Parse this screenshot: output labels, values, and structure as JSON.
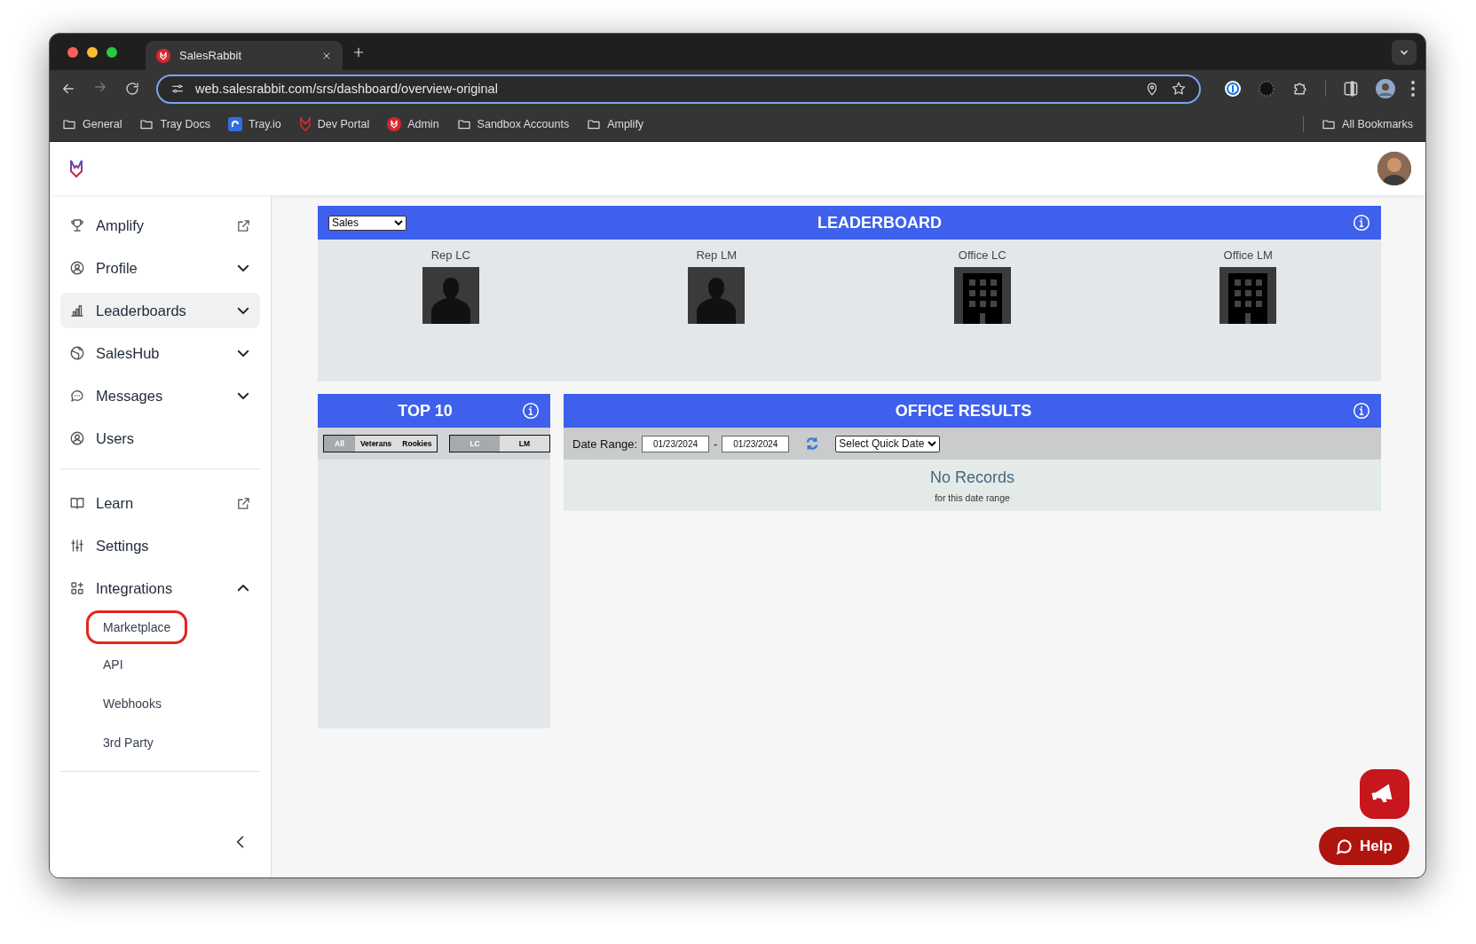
{
  "browser": {
    "tabs": [
      {
        "title": "SalesRabbit",
        "selected": true
      }
    ],
    "url": "web.salesrabbit.com/srs/dashboard/overview-original",
    "bookmarks": [
      {
        "label": "General",
        "kind": "folder"
      },
      {
        "label": "Tray Docs",
        "kind": "folder"
      },
      {
        "label": "Tray.io",
        "kind": "tray"
      },
      {
        "label": "Dev Portal",
        "kind": "rabbit"
      },
      {
        "label": "Admin",
        "kind": "badge"
      },
      {
        "label": "Sandbox Accounts",
        "kind": "folder"
      },
      {
        "label": "Amplify",
        "kind": "folder"
      }
    ],
    "all_bookmarks": "All Bookmarks"
  },
  "sidebar": {
    "groups": [
      [
        {
          "label": "Amplify",
          "kind": "link",
          "selected": false
        },
        {
          "label": "Profile",
          "kind": "menu",
          "expanded": false,
          "selected": false
        },
        {
          "label": "Leaderboards",
          "kind": "menu",
          "expanded": false,
          "selected": true
        },
        {
          "label": "SalesHub",
          "kind": "menu",
          "expanded": false,
          "selected": false
        },
        {
          "label": "Messages",
          "kind": "menu",
          "expanded": false,
          "selected": false
        },
        {
          "label": "Users",
          "kind": "page",
          "selected": false
        }
      ],
      [
        {
          "label": "Learn",
          "kind": "link",
          "selected": false
        },
        {
          "label": "Settings",
          "kind": "page",
          "selected": false
        },
        {
          "label": "Integrations",
          "kind": "menu",
          "expanded": true,
          "selected": false,
          "children": [
            {
              "label": "Marketplace",
              "highlighted": true
            },
            {
              "label": "API",
              "highlighted": false
            },
            {
              "label": "Webhooks",
              "highlighted": false
            },
            {
              "label": "3rd Party",
              "highlighted": false
            }
          ]
        }
      ]
    ]
  },
  "leaderboard": {
    "select": "Sales",
    "title": "LEADERBOARD",
    "cards": [
      {
        "label": "Rep LC",
        "kind": "person"
      },
      {
        "label": "Rep LM",
        "kind": "person"
      },
      {
        "label": "Office LC",
        "kind": "building"
      },
      {
        "label": "Office LM",
        "kind": "building"
      }
    ]
  },
  "top10": {
    "title": "TOP 10",
    "groups": [
      [
        {
          "label": "All",
          "selected": true
        },
        {
          "label": "Veterans",
          "selected": false
        },
        {
          "label": "Rookies",
          "selected": false
        }
      ],
      [
        {
          "label": "LC",
          "selected": true
        },
        {
          "label": "LM",
          "selected": false
        }
      ]
    ]
  },
  "office_results": {
    "title": "OFFICE RESULTS",
    "date_label": "Date Range:",
    "from": "01/23/2024",
    "separator": "-",
    "to": "01/23/2024",
    "quick_date": "Select Quick Date",
    "empty_title": "No Records",
    "empty_subtitle": "for this date range"
  },
  "help": {
    "label": "Help"
  }
}
